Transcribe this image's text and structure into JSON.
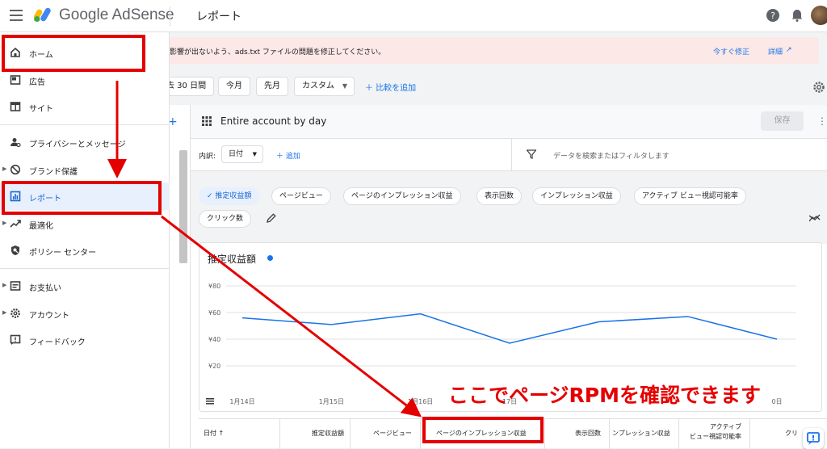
{
  "header": {
    "brand": "Google AdSense",
    "page_title": "レポート"
  },
  "banner": {
    "text": "影響が出ないよう、ads.txt ファイルの問題を修正してください。",
    "fix_link": "今すぐ修正",
    "details_link": "詳細"
  },
  "toolbar": {
    "date_partial": "去 30 日間",
    "today": "今月",
    "last_month": "先月",
    "custom": "カスタム",
    "compare": "比較を追加"
  },
  "report": {
    "name": "Entire account by day",
    "save": "保存",
    "breakdown_label": "内訳:",
    "breakdown_value": "日付",
    "add": "追加",
    "filter_placeholder": "データを検索またはフィルタします"
  },
  "metrics": [
    "推定収益額",
    "ページビュー",
    "ページのインプレッション収益",
    "表示回数",
    "インプレッション収益",
    "アクティブ ビュー視認可能率",
    "クリック数"
  ],
  "chart_data": {
    "type": "line",
    "title": "推定収益額",
    "y_ticks": [
      "¥80",
      "¥60",
      "¥40",
      "¥20"
    ],
    "ylim": [
      0,
      80
    ],
    "x_ticks": [
      "1月14日",
      "1月15日",
      "1月16日",
      "1月17日",
      "1月18日",
      "1月19日",
      "1月20日"
    ],
    "x_tick_visible": [
      "1月14日",
      "1月15日",
      "1月16日",
      "17日",
      "",
      "",
      "0日"
    ],
    "series": [
      {
        "values": [
          56,
          51,
          59,
          37,
          53,
          57,
          40
        ]
      }
    ],
    "color": "#1a73e8",
    "grid": true
  },
  "table": {
    "columns": [
      "日付",
      "推定収益額",
      "ページビュー",
      "ページのインプレッション収益",
      "表示回数",
      "ンプレッション収益",
      "アクティブ",
      "ビュー視認可能率",
      "クリ"
    ]
  },
  "sidebar": {
    "items": [
      {
        "label": "ホーム",
        "icon": "home-icon"
      },
      {
        "label": "広告",
        "icon": "ads-icon"
      },
      {
        "label": "サイト",
        "icon": "sites-icon"
      },
      {
        "label": "プライバシーとメッセージ",
        "icon": "privacy-icon"
      },
      {
        "label": "ブランド保護",
        "icon": "block-icon"
      },
      {
        "label": "レポート",
        "icon": "reports-icon"
      },
      {
        "label": "最適化",
        "icon": "trending-icon"
      },
      {
        "label": "ポリシー センター",
        "icon": "policy-icon"
      },
      {
        "label": "お支払い",
        "icon": "payments-icon"
      },
      {
        "label": "アカウント",
        "icon": "account-gear-icon"
      },
      {
        "label": "フィードバック",
        "icon": "feedback-icon"
      }
    ]
  },
  "annotation": "ここでページRPMを確認できます"
}
